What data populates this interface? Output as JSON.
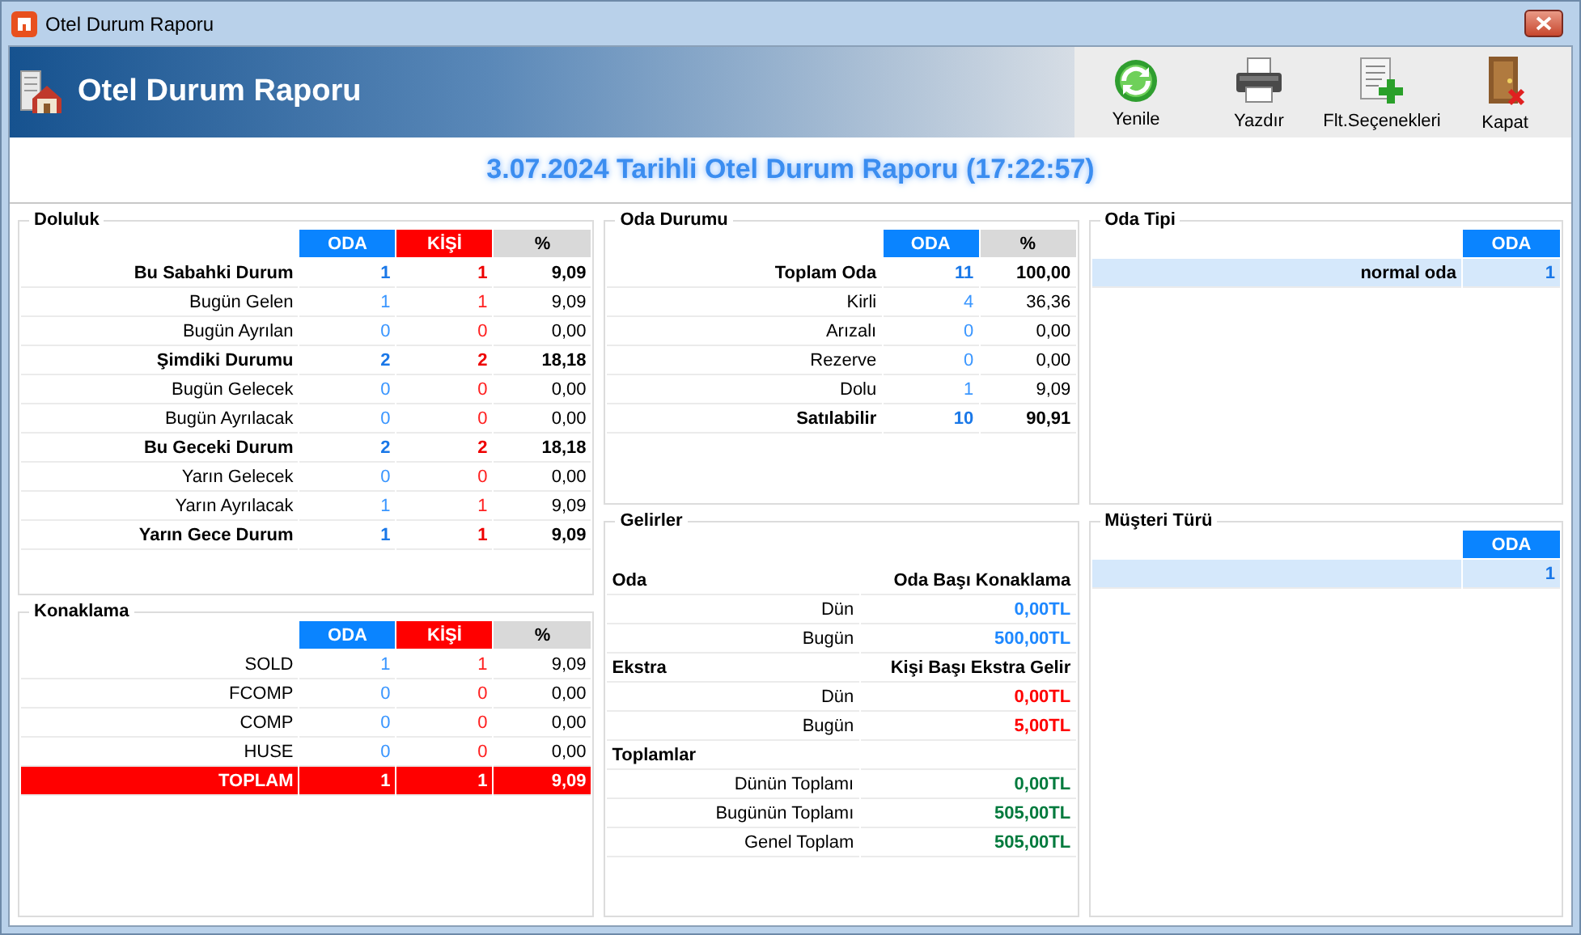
{
  "window": {
    "title": "Otel Durum Raporu"
  },
  "header": {
    "title": "Otel Durum Raporu"
  },
  "toolbar": [
    {
      "label": "Yenile",
      "kind": "refresh"
    },
    {
      "label": "Yazdır",
      "kind": "print"
    },
    {
      "label": "Flt.Seçenekleri",
      "kind": "filter"
    },
    {
      "label": "Kapat",
      "kind": "close"
    }
  ],
  "report_title": "3.07.2024 Tarihli Otel Durum Raporu (17:22:57)",
  "doluluk": {
    "title": "Doluluk",
    "columns": [
      {
        "label": "ODA",
        "kind": "oda"
      },
      {
        "label": "KİŞİ",
        "kind": "kisi"
      },
      {
        "label": "%",
        "kind": "pct"
      }
    ],
    "rows": [
      {
        "label": "Bu Sabahki Durum",
        "values": [
          "1",
          "1",
          "9,09"
        ],
        "bold": true
      },
      {
        "label": "Bugün Gelen",
        "values": [
          "1",
          "1",
          "9,09"
        ],
        "bold": false
      },
      {
        "label": "Bugün Ayrılan",
        "values": [
          "0",
          "0",
          "0,00"
        ],
        "bold": false
      },
      {
        "label": "Şimdiki Durumu",
        "values": [
          "2",
          "2",
          "18,18"
        ],
        "bold": true
      },
      {
        "label": "Bugün Gelecek",
        "values": [
          "0",
          "0",
          "0,00"
        ],
        "bold": false
      },
      {
        "label": "Bugün Ayrılacak",
        "values": [
          "0",
          "0",
          "0,00"
        ],
        "bold": false
      },
      {
        "label": "Bu Geceki Durum",
        "values": [
          "2",
          "2",
          "18,18"
        ],
        "bold": true
      },
      {
        "label": "Yarın Gelecek",
        "values": [
          "0",
          "0",
          "0,00"
        ],
        "bold": false
      },
      {
        "label": "Yarın Ayrılacak",
        "values": [
          "1",
          "1",
          "9,09"
        ],
        "bold": false
      },
      {
        "label": "Yarın Gece Durum",
        "values": [
          "1",
          "1",
          "9,09"
        ],
        "bold": true
      }
    ]
  },
  "konaklama": {
    "title": "Konaklama",
    "columns": [
      {
        "label": "ODA",
        "kind": "oda"
      },
      {
        "label": "KİŞİ",
        "kind": "kisi"
      },
      {
        "label": "%",
        "kind": "pct"
      }
    ],
    "rows": [
      {
        "label": "SOLD",
        "values": [
          "1",
          "1",
          "9,09"
        ],
        "kind": "normal"
      },
      {
        "label": "FCOMP",
        "values": [
          "0",
          "0",
          "0,00"
        ],
        "kind": "normal"
      },
      {
        "label": "COMP",
        "values": [
          "0",
          "0",
          "0,00"
        ],
        "kind": "normal"
      },
      {
        "label": "HUSE",
        "values": [
          "0",
          "0",
          "0,00"
        ],
        "kind": "normal"
      },
      {
        "label": "TOPLAM",
        "values": [
          "1",
          "1",
          "9,09"
        ],
        "kind": "total"
      }
    ]
  },
  "oda_durumu": {
    "title": "Oda Durumu",
    "columns": [
      {
        "label": "ODA",
        "kind": "oda"
      },
      {
        "label": "%",
        "kind": "pct"
      }
    ],
    "rows": [
      {
        "label": "Toplam Oda",
        "values": [
          "11",
          "100,00"
        ],
        "bold": true
      },
      {
        "label": "Kirli",
        "values": [
          "4",
          "36,36"
        ],
        "bold": false
      },
      {
        "label": "Arızalı",
        "values": [
          "0",
          "0,00"
        ],
        "bold": false
      },
      {
        "label": "Rezerve",
        "values": [
          "0",
          "0,00"
        ],
        "bold": false
      },
      {
        "label": "Dolu",
        "values": [
          "1",
          "9,09"
        ],
        "bold": false
      },
      {
        "label": "Satılabilir",
        "values": [
          "10",
          "90,91"
        ],
        "bold": true
      }
    ]
  },
  "gelirler": {
    "title": "Gelirler",
    "rows": [
      {
        "kind": "section",
        "label": "Oda",
        "heading": "Oda Başı Konaklama"
      },
      {
        "kind": "value",
        "label": "Dün",
        "value": "0,00TL",
        "color": "#1e88ff"
      },
      {
        "kind": "value",
        "label": "Bugün",
        "value": "500,00TL",
        "color": "#1e88ff"
      },
      {
        "kind": "section",
        "label": "Ekstra",
        "heading": "Kişi Başı Ekstra Gelir"
      },
      {
        "kind": "value",
        "label": "Dün",
        "value": "0,00TL",
        "color": "#ff0000"
      },
      {
        "kind": "value",
        "label": "Bugün",
        "value": "5,00TL",
        "color": "#ff0000"
      },
      {
        "kind": "section",
        "label": "Toplamlar"
      },
      {
        "kind": "value",
        "label": "Dünün Toplamı",
        "value": "0,00TL",
        "color": "#007a3d"
      },
      {
        "kind": "value",
        "label": "Bugünün Toplamı",
        "value": "505,00TL",
        "color": "#007a3d"
      },
      {
        "kind": "value",
        "label": "Genel Toplam",
        "value": "505,00TL",
        "color": "#007a3d"
      }
    ]
  },
  "oda_tipi": {
    "title": "Oda Tipi",
    "columns": [
      {
        "label": "ODA",
        "kind": "oda"
      }
    ],
    "rows": [
      {
        "label": "normal oda",
        "values": [
          "1"
        ],
        "selected": true
      }
    ]
  },
  "musteri_turu": {
    "title": "Müşteri Türü",
    "columns": [
      {
        "label": "ODA",
        "kind": "oda"
      }
    ],
    "rows": [
      {
        "values": [
          "1"
        ],
        "selected": true
      }
    ]
  }
}
